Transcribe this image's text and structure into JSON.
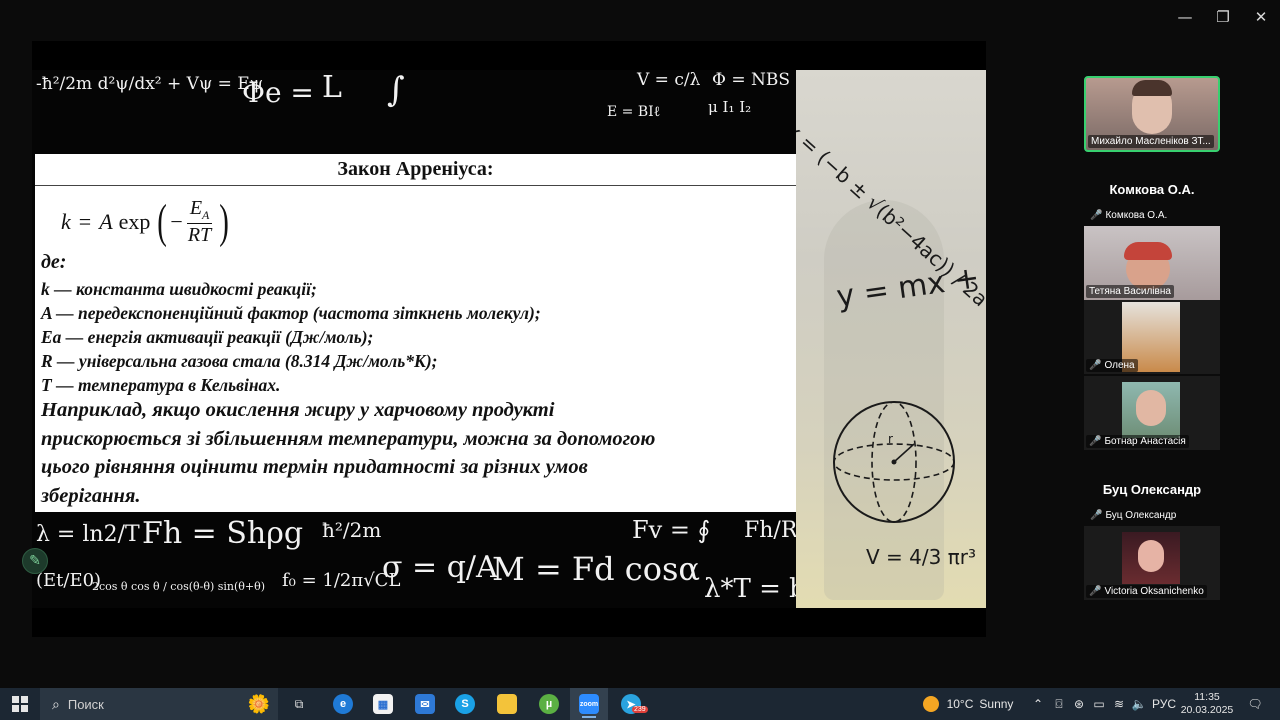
{
  "window": {
    "controls": [
      "—",
      "❐",
      "✕"
    ]
  },
  "slide": {
    "title": "Закон Арреніуса:",
    "formula": {
      "lhs": "k",
      "eq": "=",
      "a": "A",
      "fn": "exp",
      "minus": "−",
      "num": "E",
      "num_sub": "A",
      "den": "RT"
    },
    "de": "де:",
    "definitions": [
      "k — константа швидкості реакції;",
      "A — передекспоненційний фактор (частота зіткнень молекул);",
      "Ea — енергія активації реакції (Дж/моль);",
      "R — універсальна газова стала (8.314 Дж/моль*К);",
      "T — температура в Кельвінах."
    ],
    "example_lines": [
      "Наприклад, якщо окислення жиру у харчовому продукті",
      "прискорюється зі збільшенням температури, можна за допомогою",
      "цього рівняння оцінити термін придатності за різних умов",
      "зберігання."
    ],
    "chalk": {
      "top": [
        "-ħ²/2m d²ψ/dx² + Vψ = Eψ",
        "Φe =",
        "L",
        "∫",
        "V = c/λ",
        "Φ = NBS",
        "E = BIℓ",
        "μ I₁ I₂"
      ],
      "bottom": [
        "λ = ln2/T",
        "Fh = Shρg",
        "ħ²/2m",
        "σ = q/A",
        "M = Fd cosα",
        "Fv = ∮",
        "Fh/R",
        "f₀ = 1/2π√CL",
        "λ*T = b",
        "(Et/E0)",
        "2cos θ cos θ / cos(θ-θ) sin(θ+θ)"
      ]
    },
    "handwriting": {
      "quadratic": "x = (−b ± √(b²−4ac)) / 2a",
      "line": "y = mx + b",
      "sphere": "V = 4/3 πr³",
      "r": "r"
    }
  },
  "participants": [
    {
      "type": "video",
      "name": "Михайло Масленіков ЗТ...",
      "active": true
    },
    {
      "type": "name_card",
      "display": "Комкова О.А.",
      "name": "Комкова О.А.",
      "muted": true
    },
    {
      "type": "video",
      "name": "Тетяна Василівна",
      "muted": false
    },
    {
      "type": "video",
      "name": "Олена",
      "muted": true
    },
    {
      "type": "video",
      "name": "Ботнар Анастасія",
      "muted": true
    },
    {
      "type": "name_card",
      "display": "Буц Олександр",
      "name": "Буц Олександр",
      "muted": true
    },
    {
      "type": "video",
      "name": "Victoria Oksanichenko",
      "muted": true
    }
  ],
  "taskbar": {
    "search_label": "Поиск",
    "weather": {
      "temp": "10°C",
      "condition": "Sunny"
    },
    "lang": "РУС",
    "time": "11:35",
    "date": "20.03.2025",
    "telegram_badge": "239",
    "zoom_label": "zoom"
  },
  "colors": {
    "active_border": "#38d06f",
    "muted_icon": "#e04040",
    "taskbar": "#1c2733"
  }
}
